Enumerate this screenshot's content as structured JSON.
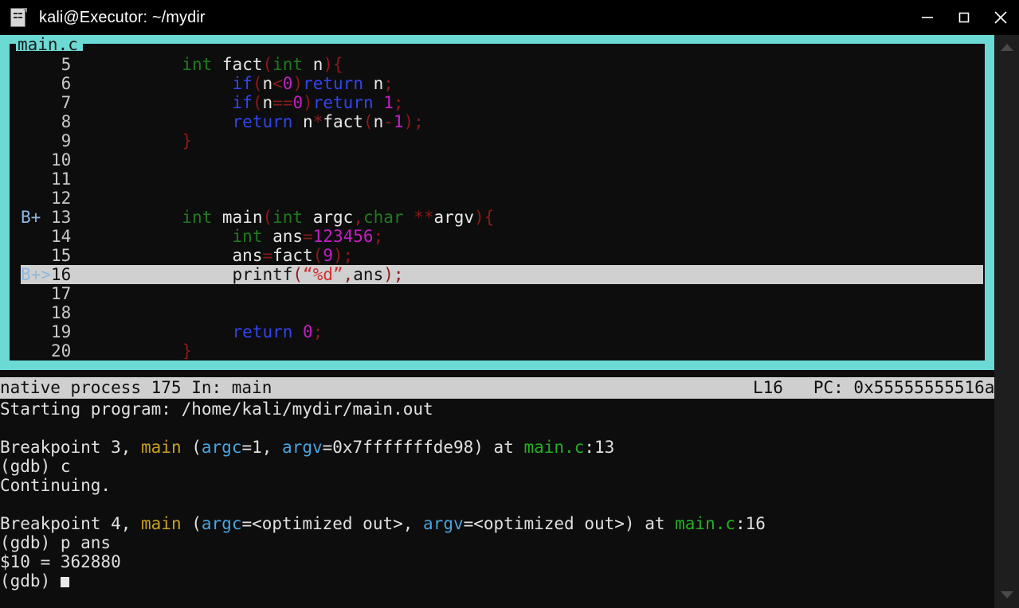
{
  "window": {
    "title": "kali@Executor: ~/mydir",
    "icon": "terminal-document-icon",
    "controls": {
      "minimize": "minimize-button",
      "maximize": "maximize-button",
      "close": "close-button"
    }
  },
  "colors": {
    "frame_cyan": "#6bd9d4",
    "terminal_bg": "#0d0d0d",
    "statusbar_bg": "#cfcfcf",
    "highlight_bg": "#d0d0d0",
    "keyword_green": "#1f7a1f",
    "control_blue": "#3344ee",
    "punct_red": "#8c1a1a",
    "number_magenta": "#c41fc4",
    "string_red": "#d03030",
    "console_fn_orange": "#c8a020",
    "console_var_blue": "#4aa3df",
    "console_file_green": "#22b022"
  },
  "source_panel": {
    "label": "main.c",
    "lines": [
      {
        "mark": "",
        "num": "5",
        "highlight": false,
        "tokens": [
          {
            "t": "           ",
            "c": "plain"
          },
          {
            "t": "int",
            "c": "kw"
          },
          {
            "t": " ",
            "c": "plain"
          },
          {
            "t": "fact",
            "c": "fn"
          },
          {
            "t": "(",
            "c": "punc"
          },
          {
            "t": "int",
            "c": "kw"
          },
          {
            "t": " ",
            "c": "plain"
          },
          {
            "t": "n",
            "c": "plain"
          },
          {
            "t": ")",
            "c": "punc"
          },
          {
            "t": "{",
            "c": "punc"
          }
        ]
      },
      {
        "mark": "",
        "num": "6",
        "highlight": false,
        "tokens": [
          {
            "t": "                ",
            "c": "plain"
          },
          {
            "t": "if",
            "c": "ctl"
          },
          {
            "t": "(",
            "c": "punc"
          },
          {
            "t": "n",
            "c": "plain"
          },
          {
            "t": "<",
            "c": "punc"
          },
          {
            "t": "0",
            "c": "num"
          },
          {
            "t": ")",
            "c": "punc"
          },
          {
            "t": "return",
            "c": "ctl"
          },
          {
            "t": " n",
            "c": "plain"
          },
          {
            "t": ";",
            "c": "punc"
          }
        ]
      },
      {
        "mark": "",
        "num": "7",
        "highlight": false,
        "tokens": [
          {
            "t": "                ",
            "c": "plain"
          },
          {
            "t": "if",
            "c": "ctl"
          },
          {
            "t": "(",
            "c": "punc"
          },
          {
            "t": "n",
            "c": "plain"
          },
          {
            "t": "==",
            "c": "punc"
          },
          {
            "t": "0",
            "c": "num"
          },
          {
            "t": ")",
            "c": "punc"
          },
          {
            "t": "return",
            "c": "ctl"
          },
          {
            "t": " ",
            "c": "plain"
          },
          {
            "t": "1",
            "c": "num"
          },
          {
            "t": ";",
            "c": "punc"
          }
        ]
      },
      {
        "mark": "",
        "num": "8",
        "highlight": false,
        "tokens": [
          {
            "t": "                ",
            "c": "plain"
          },
          {
            "t": "return",
            "c": "ctl"
          },
          {
            "t": " n",
            "c": "plain"
          },
          {
            "t": "*",
            "c": "punc"
          },
          {
            "t": "fact",
            "c": "fn"
          },
          {
            "t": "(",
            "c": "punc"
          },
          {
            "t": "n",
            "c": "plain"
          },
          {
            "t": "-",
            "c": "punc"
          },
          {
            "t": "1",
            "c": "num"
          },
          {
            "t": ")",
            "c": "punc"
          },
          {
            "t": ";",
            "c": "punc"
          }
        ]
      },
      {
        "mark": "",
        "num": "9",
        "highlight": false,
        "tokens": [
          {
            "t": "           ",
            "c": "plain"
          },
          {
            "t": "}",
            "c": "punc"
          }
        ]
      },
      {
        "mark": "",
        "num": "10",
        "highlight": false,
        "tokens": []
      },
      {
        "mark": "",
        "num": "11",
        "highlight": false,
        "tokens": []
      },
      {
        "mark": "",
        "num": "12",
        "highlight": false,
        "tokens": []
      },
      {
        "mark": "B+",
        "num": "13",
        "highlight": false,
        "tokens": [
          {
            "t": "           ",
            "c": "plain"
          },
          {
            "t": "int",
            "c": "kw"
          },
          {
            "t": " ",
            "c": "plain"
          },
          {
            "t": "main",
            "c": "fn"
          },
          {
            "t": "(",
            "c": "punc"
          },
          {
            "t": "int",
            "c": "kw"
          },
          {
            "t": " ",
            "c": "plain"
          },
          {
            "t": "argc",
            "c": "plain"
          },
          {
            "t": ",",
            "c": "punc"
          },
          {
            "t": "char",
            "c": "kw"
          },
          {
            "t": " ",
            "c": "plain"
          },
          {
            "t": "**",
            "c": "punc"
          },
          {
            "t": "argv",
            "c": "plain"
          },
          {
            "t": ")",
            "c": "punc"
          },
          {
            "t": "{",
            "c": "punc"
          }
        ]
      },
      {
        "mark": "",
        "num": "14",
        "highlight": false,
        "tokens": [
          {
            "t": "                ",
            "c": "plain"
          },
          {
            "t": "int",
            "c": "kw"
          },
          {
            "t": " ans",
            "c": "plain"
          },
          {
            "t": "=",
            "c": "punc"
          },
          {
            "t": "123456",
            "c": "num"
          },
          {
            "t": ";",
            "c": "punc"
          }
        ]
      },
      {
        "mark": "",
        "num": "15",
        "highlight": false,
        "tokens": [
          {
            "t": "                ",
            "c": "plain"
          },
          {
            "t": "ans",
            "c": "plain"
          },
          {
            "t": "=",
            "c": "punc"
          },
          {
            "t": "fact",
            "c": "fn"
          },
          {
            "t": "(",
            "c": "punc"
          },
          {
            "t": "9",
            "c": "num"
          },
          {
            "t": ")",
            "c": "punc"
          },
          {
            "t": ";",
            "c": "punc"
          }
        ]
      },
      {
        "mark": "B+>",
        "num": "16",
        "highlight": true,
        "tokens": [
          {
            "t": "                ",
            "c": "plain"
          },
          {
            "t": "printf",
            "c": "fn"
          },
          {
            "t": "(",
            "c": "punc"
          },
          {
            "t": "“%d”",
            "c": "str"
          },
          {
            "t": ",",
            "c": "punc"
          },
          {
            "t": "ans",
            "c": "plain"
          },
          {
            "t": ")",
            "c": "punc"
          },
          {
            "t": ";",
            "c": "punc"
          }
        ]
      },
      {
        "mark": "",
        "num": "17",
        "highlight": false,
        "tokens": []
      },
      {
        "mark": "",
        "num": "18",
        "highlight": false,
        "tokens": []
      },
      {
        "mark": "",
        "num": "19",
        "highlight": false,
        "tokens": [
          {
            "t": "                ",
            "c": "plain"
          },
          {
            "t": "return",
            "c": "ctl"
          },
          {
            "t": " ",
            "c": "plain"
          },
          {
            "t": "0",
            "c": "num"
          },
          {
            "t": ";",
            "c": "punc"
          }
        ]
      },
      {
        "mark": "",
        "num": "20",
        "highlight": false,
        "tokens": [
          {
            "t": "           ",
            "c": "plain"
          },
          {
            "t": "}",
            "c": "punc"
          }
        ]
      }
    ]
  },
  "statusbar": {
    "left": "native process 175 In: main",
    "right": "L16   PC: 0x55555555516a"
  },
  "console": {
    "lines": [
      [
        {
          "t": "Starting program: /home/kali/mydir/main.out",
          "c": "c-white"
        }
      ],
      [],
      [
        {
          "t": "Breakpoint 4, ",
          "c": "c-white"
        }
      ],
      [
        {
          "t": "(gdb) c",
          "c": "c-white"
        }
      ]
    ],
    "rendered_lines": [
      [
        {
          "t": "Starting program: /home/kali/mydir/main.out",
          "c": "c-white"
        }
      ],
      [],
      [
        {
          "t": "Breakpoint 3, ",
          "c": "c-white"
        },
        {
          "t": "main",
          "c": "c-fn"
        },
        {
          "t": " (",
          "c": "c-white"
        },
        {
          "t": "argc",
          "c": "c-var"
        },
        {
          "t": "=1, ",
          "c": "c-white"
        },
        {
          "t": "argv",
          "c": "c-var"
        },
        {
          "t": "=0x7fffffffde98) at ",
          "c": "c-white"
        },
        {
          "t": "main.c",
          "c": "c-file"
        },
        {
          "t": ":13",
          "c": "c-white"
        }
      ],
      [
        {
          "t": "(gdb) c",
          "c": "c-white"
        }
      ],
      [
        {
          "t": "Continuing.",
          "c": "c-white"
        }
      ],
      [],
      [
        {
          "t": "Breakpoint 4, ",
          "c": "c-white"
        },
        {
          "t": "main",
          "c": "c-fn"
        },
        {
          "t": " (",
          "c": "c-white"
        },
        {
          "t": "argc",
          "c": "c-var"
        },
        {
          "t": "=<optimized out>, ",
          "c": "c-white"
        },
        {
          "t": "argv",
          "c": "c-var"
        },
        {
          "t": "=<optimized out>) at ",
          "c": "c-white"
        },
        {
          "t": "main.c",
          "c": "c-file"
        },
        {
          "t": ":16",
          "c": "c-white"
        }
      ],
      [
        {
          "t": "(gdb) p ans",
          "c": "c-white"
        }
      ],
      [
        {
          "t": "$10 = 362880",
          "c": "c-white"
        }
      ],
      [
        {
          "t": "(gdb) ",
          "c": "c-white"
        },
        {
          "cursor": true
        }
      ]
    ]
  },
  "scrollbar": {
    "up_arrow": "scroll-up-arrow-icon",
    "down_arrow": "scroll-down-arrow-icon"
  }
}
